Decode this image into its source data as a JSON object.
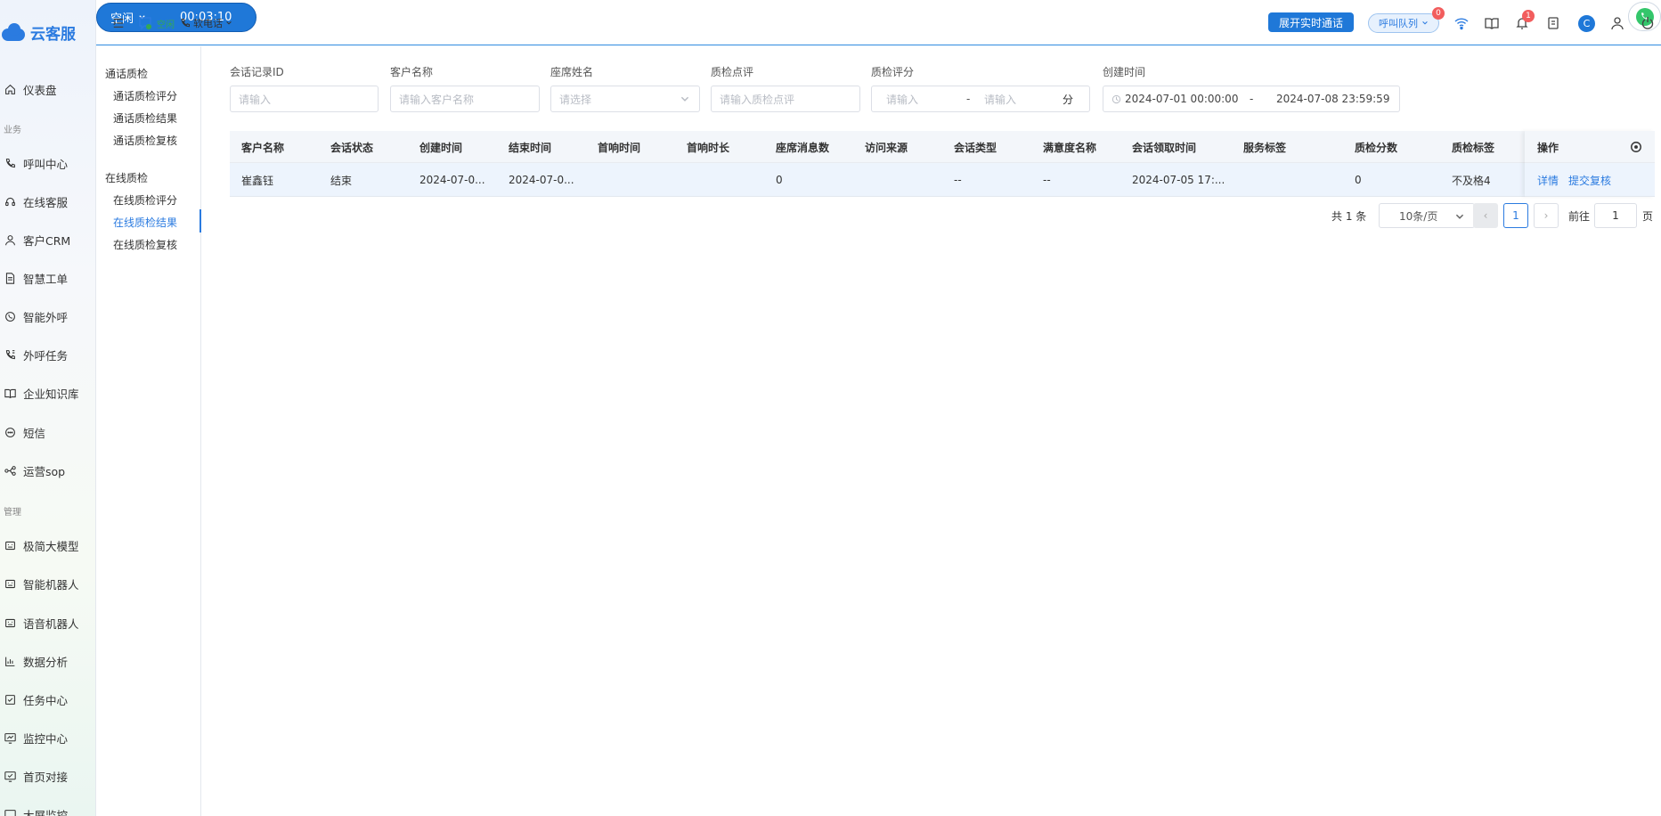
{
  "brand": {
    "name": "云客服"
  },
  "nav": {
    "groups": [
      {
        "label": "业务"
      },
      {
        "label": "管理"
      }
    ],
    "items": [
      {
        "label": "仪表盘",
        "icon": "home-icon"
      },
      {
        "label": "呼叫中心",
        "icon": "phone-icon"
      },
      {
        "label": "在线客服",
        "icon": "headset-icon"
      },
      {
        "label": "客户CRM",
        "icon": "user-icon"
      },
      {
        "label": "智慧工单",
        "icon": "document-icon"
      },
      {
        "label": "智能外呼",
        "icon": "whatsapp-icon"
      },
      {
        "label": "外呼任务",
        "icon": "phone-task-icon"
      },
      {
        "label": "企业知识库",
        "icon": "book-icon"
      },
      {
        "label": "短信",
        "icon": "sms-icon"
      },
      {
        "label": "运营sop",
        "icon": "flow-icon"
      },
      {
        "label": "极简大模型",
        "icon": "robot-icon"
      },
      {
        "label": "智能机器人",
        "icon": "robot-icon"
      },
      {
        "label": "语音机器人",
        "icon": "robot-icon"
      },
      {
        "label": "数据分析",
        "icon": "chart-icon"
      },
      {
        "label": "任务中心",
        "icon": "checklist-icon"
      },
      {
        "label": "监控中心",
        "icon": "monitor-icon"
      },
      {
        "label": "首页对接",
        "icon": "monitor-check-icon"
      },
      {
        "label": "大屏监控",
        "icon": "screen-icon"
      }
    ]
  },
  "topbar": {
    "status_text": "空闲",
    "softphone_label": "软电话",
    "call_status": "空闲",
    "call_timer": "00:03:10",
    "expand_call_label": "展开实时通话",
    "queue_label": "呼叫队列",
    "queue_badge": "0",
    "notify_badge": "1",
    "avatar_letter": "C"
  },
  "subnav": {
    "groups": [
      {
        "label": "通话质检",
        "items": [
          "通话质检评分",
          "通话质检结果",
          "通话质检复核"
        ]
      },
      {
        "label": "在线质检",
        "items": [
          "在线质检评分",
          "在线质检结果",
          "在线质检复核"
        ]
      }
    ],
    "active": "在线质检结果"
  },
  "filters": {
    "session_id": {
      "label": "会话记录ID",
      "placeholder": "请输入"
    },
    "customer_name": {
      "label": "客户名称",
      "placeholder": "请输入客户名称"
    },
    "agent_name": {
      "label": "座席姓名",
      "placeholder": "请选择"
    },
    "qc_comment": {
      "label": "质检点评",
      "placeholder": "请输入质检点评"
    },
    "qc_score": {
      "label": "质检评分",
      "min_placeholder": "请输入",
      "dash": "-",
      "max_placeholder": "请输入",
      "unit": "分"
    },
    "created_time": {
      "label": "创建时间",
      "start": "2024-07-01 00:00:00",
      "dash": "-",
      "end": "2024-07-08 23:59:59"
    }
  },
  "table": {
    "columns": [
      "客户名称",
      "会话状态",
      "创建时间",
      "结束时间",
      "首响时间",
      "首响时长",
      "座席消息数",
      "访问来源",
      "会话类型",
      "满意度名称",
      "会话领取时间",
      "服务标签",
      "质检分数",
      "质检标签",
      "操作"
    ],
    "rows": [
      {
        "cells": [
          "崔鑫钰",
          "结束",
          "2024-07-0...",
          "2024-07-0...",
          "",
          "",
          "0",
          "",
          "--",
          "--",
          "2024-07-05 17:...",
          "",
          "0",
          "不及格4"
        ],
        "actions": [
          "详情",
          "提交复核"
        ]
      }
    ]
  },
  "pagination": {
    "total": "共 1 条",
    "page_size": "10条/页",
    "prev": "‹",
    "current": "1",
    "next": "›",
    "goto_label": "前往",
    "goto_value": "1",
    "page_suffix": "页"
  },
  "colors": {
    "primary": "#1f78d8",
    "link": "#2b7be0",
    "success": "#34c66b",
    "badge": "#f25d5d"
  }
}
